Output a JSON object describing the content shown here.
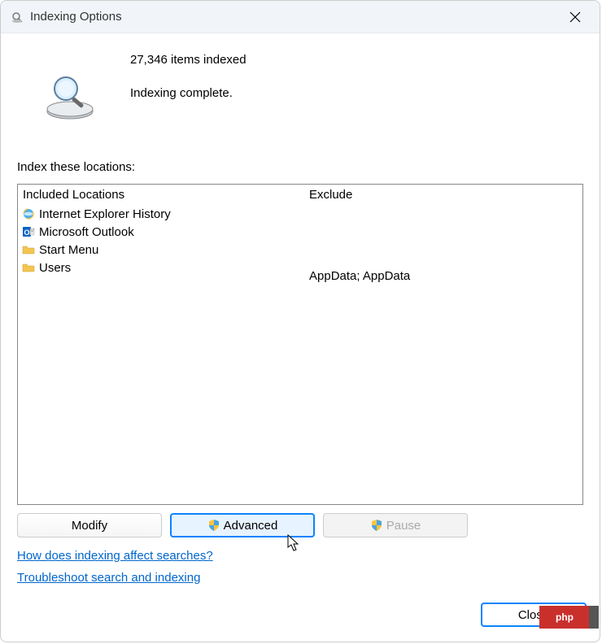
{
  "titlebar": {
    "title": "Indexing Options"
  },
  "status": {
    "count_text": "27,346 items indexed",
    "state_text": "Indexing complete."
  },
  "locations": {
    "label": "Index these locations:",
    "columns": {
      "included": "Included Locations",
      "exclude": "Exclude"
    },
    "rows": [
      {
        "icon": "ie",
        "name": "Internet Explorer History",
        "exclude": ""
      },
      {
        "icon": "outlook",
        "name": "Microsoft Outlook",
        "exclude": ""
      },
      {
        "icon": "folder",
        "name": "Start Menu",
        "exclude": ""
      },
      {
        "icon": "folder",
        "name": "Users",
        "exclude": "AppData; AppData"
      }
    ]
  },
  "buttons": {
    "modify": "Modify",
    "advanced": "Advanced",
    "pause": "Pause",
    "close": "Close"
  },
  "links": {
    "help": "How does indexing affect searches?",
    "troubleshoot": "Troubleshoot search and indexing"
  },
  "watermark": "php"
}
